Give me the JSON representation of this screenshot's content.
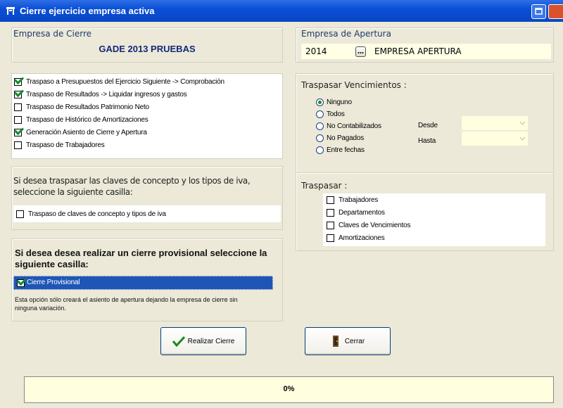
{
  "window": {
    "title": "Cierre ejercicio empresa activa"
  },
  "empresa_cierre": {
    "label": "Empresa de Cierre",
    "name": "GADE 2013 PRUEBAS"
  },
  "empresa_apertura": {
    "label": "Empresa de Apertura",
    "year": "2014",
    "name": "EMPRESA APERTURA"
  },
  "traspasos": [
    {
      "label": "Traspaso a Presupuestos del Ejercicio Siguiente -> Comprobación",
      "checked": true
    },
    {
      "label": "Traspaso de Resultados -> Liquidar ingresos y gastos",
      "checked": true
    },
    {
      "label": "Traspaso de Resultados Patrimonio Neto",
      "checked": false
    },
    {
      "label": "Traspaso de Histórico de Amortizaciones",
      "checked": false
    },
    {
      "label": "Generación Asiento de Cierre y Apertura",
      "checked": true
    },
    {
      "label": "Traspaso de Trabajadores",
      "checked": false
    }
  ],
  "claves": {
    "text": "Si desea traspasar las claves de concepto y los tipos de iva, seleccione la siguiente casilla:",
    "checkbox": "Traspaso de claves de concepto y tipos de iva"
  },
  "provisional": {
    "text": "Si desea desea realizar un cierre provisional seleccione la siguiente casilla:",
    "checkbox": "Cierre Provisional",
    "note": "Esta opción sólo creará el asiento de apertura dejando la empresa de cierre sin ninguna variación."
  },
  "vencimientos": {
    "label": "Traspasar Vencimientos :",
    "options": [
      "Ninguno",
      "Todos",
      "No Contabilizados",
      "No Pagados",
      "Entre fechas"
    ],
    "selected": 0,
    "desde": "Desde",
    "hasta": "Hasta"
  },
  "traspasar": {
    "label": "Traspasar :",
    "items": [
      "Trabajadores",
      "Departamentos",
      "Claves de Vencimientos",
      "Amortizaciones"
    ]
  },
  "buttons": {
    "realizar": "Realizar Cierre",
    "cerrar": "Cerrar"
  },
  "status": {
    "text": "0%"
  }
}
